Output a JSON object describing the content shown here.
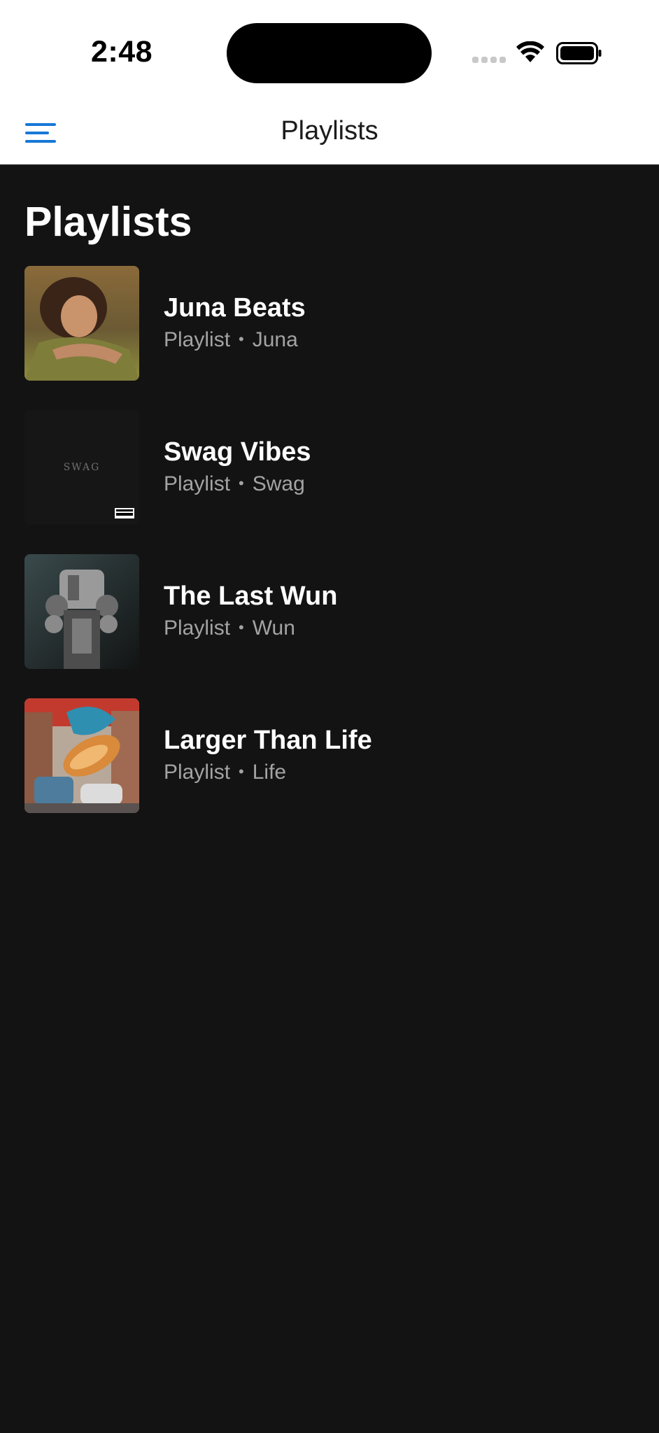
{
  "status_bar": {
    "time": "2:48"
  },
  "nav": {
    "title": "Playlists",
    "menu_icon": "hamburger-menu-icon",
    "accent_color": "#1878d6"
  },
  "page": {
    "title": "Playlists"
  },
  "playlists": [
    {
      "title": "Juna Beats",
      "type": "Playlist",
      "separator": "•",
      "owner": "Juna"
    },
    {
      "title": "Swag Vibes",
      "type": "Playlist",
      "separator": "•",
      "owner": "Swag",
      "cover_text": "SWAG",
      "cover_badge": "PARENTAL ADVISORY"
    },
    {
      "title": "The Last Wun",
      "type": "Playlist",
      "separator": "•",
      "owner": "Wun"
    },
    {
      "title": "Larger Than Life",
      "type": "Playlist",
      "separator": "•",
      "owner": "Life"
    }
  ],
  "colors": {
    "background": "#131313",
    "header_background": "#ffffff",
    "title_text": "#ffffff",
    "subtitle_text": "#a3a3a3"
  }
}
